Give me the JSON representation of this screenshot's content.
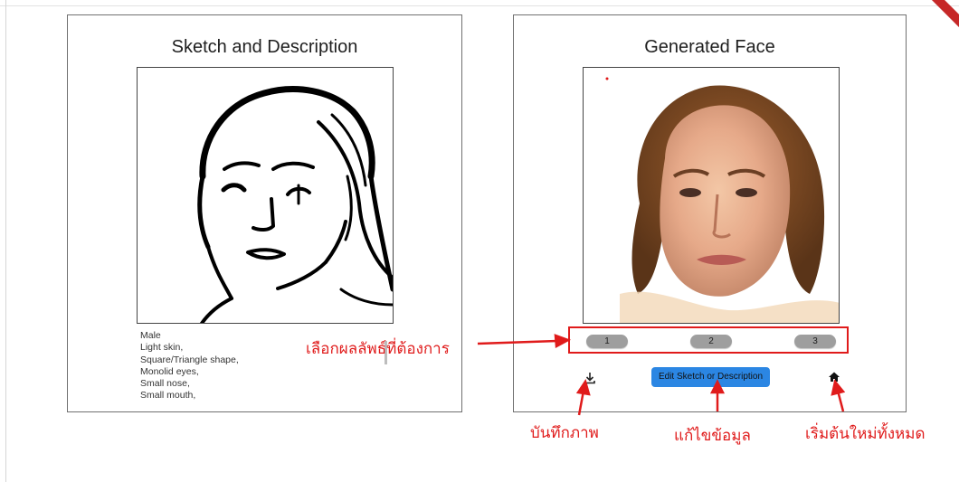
{
  "left_panel": {
    "title": "Sketch and Description",
    "description_lines": [
      "Male",
      "Light skin,",
      "Square/Triangle shape,",
      "Monolid eyes,",
      "Small nose,",
      "Small mouth,"
    ]
  },
  "right_panel": {
    "title": "Generated Face",
    "result_buttons": [
      "1",
      "2",
      "3"
    ],
    "edit_button_label": "Edit Sketch or Description",
    "save_icon": "download-icon",
    "home_icon": "home-icon"
  },
  "annotations": {
    "select_result": "เลือกผลลัพธ์ที่ต้องการ",
    "save_image": "บันทึกภาพ",
    "edit_data": "แก้ไขข้อมูล",
    "restart": "เริ่มต้นใหม่ทั้งหมด"
  },
  "colors": {
    "annotation_red": "#e01b1b",
    "edit_button_blue": "#2b86e3",
    "result_button_gray": "#9e9e9e"
  }
}
